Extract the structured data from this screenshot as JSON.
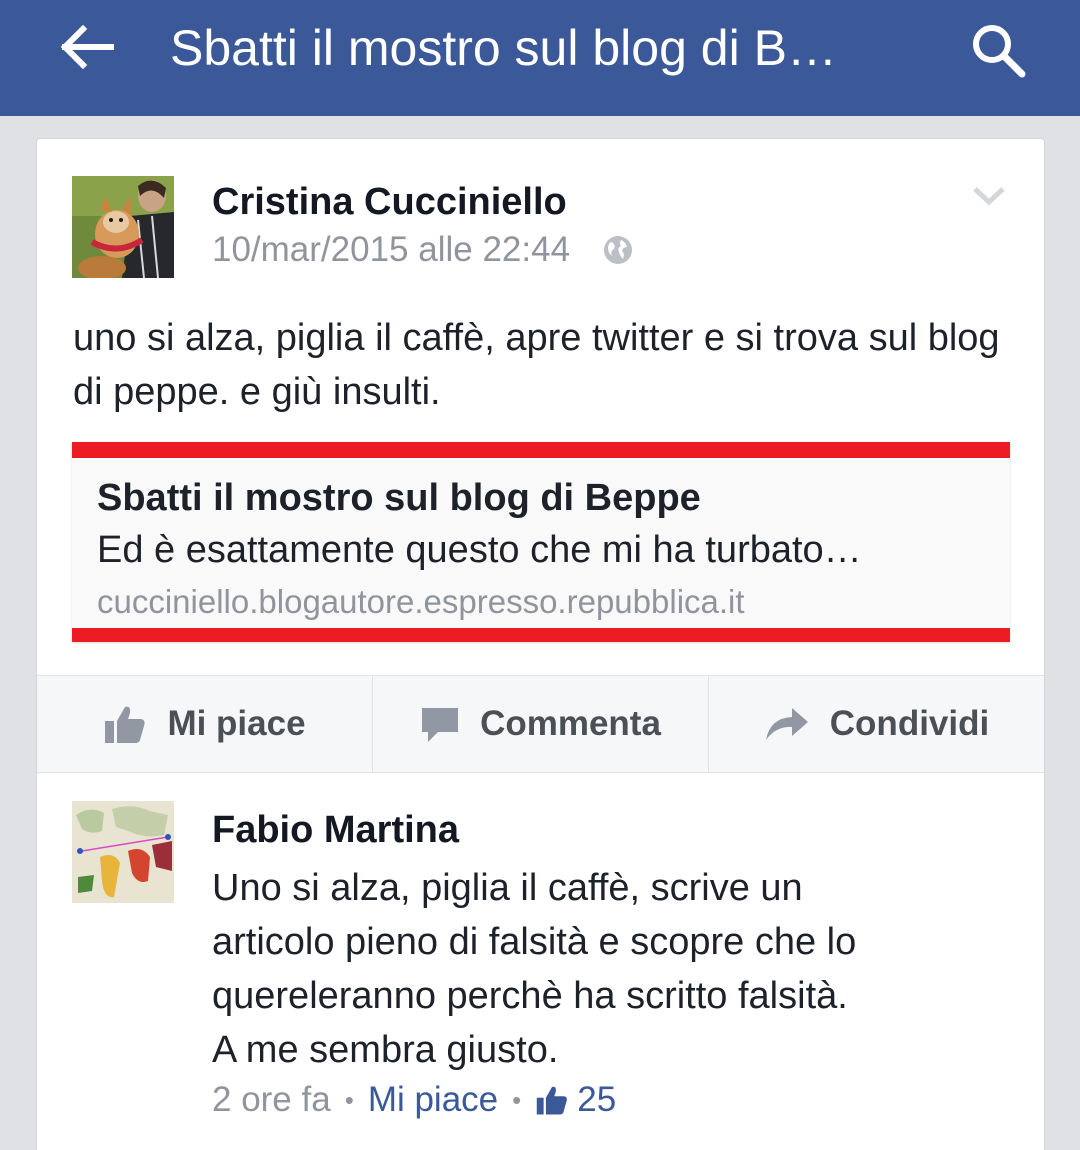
{
  "header": {
    "title": "Sbatti il mostro sul blog di B…",
    "back_icon": "arrow-left-icon",
    "search_icon": "search-icon",
    "background": "#3b5998"
  },
  "post": {
    "author": "Cristina Cucciniello",
    "timestamp": "10/mar/2015 alle 22:44",
    "privacy_icon": "globe-icon",
    "menu_icon": "chevron-down-icon",
    "text": "uno si alza, piglia il caffè, apre twitter e si trova sul blog di peppe. e giù insulti.",
    "link": {
      "title": "Sbatti il mostro sul blog di Beppe",
      "description": "Ed è esattamente questo che mi ha turbato…",
      "domain": "cucciniello.blogautore.espresso.repubblica.it",
      "accent": "#ed1c24"
    }
  },
  "actions": {
    "like": "Mi piace",
    "comment": "Commenta",
    "share": "Condividi"
  },
  "comment": {
    "author": "Fabio Martina",
    "lines": [
      "Uno si alza, piglia il caffè, scrive un",
      "articolo pieno di falsità e scopre che lo",
      "quereleranno perchè ha scritto falsità.",
      "A me sembra giusto."
    ],
    "time": "2 ore fa",
    "separator": "•",
    "like_label": "Mi piace",
    "like_count": "25"
  }
}
